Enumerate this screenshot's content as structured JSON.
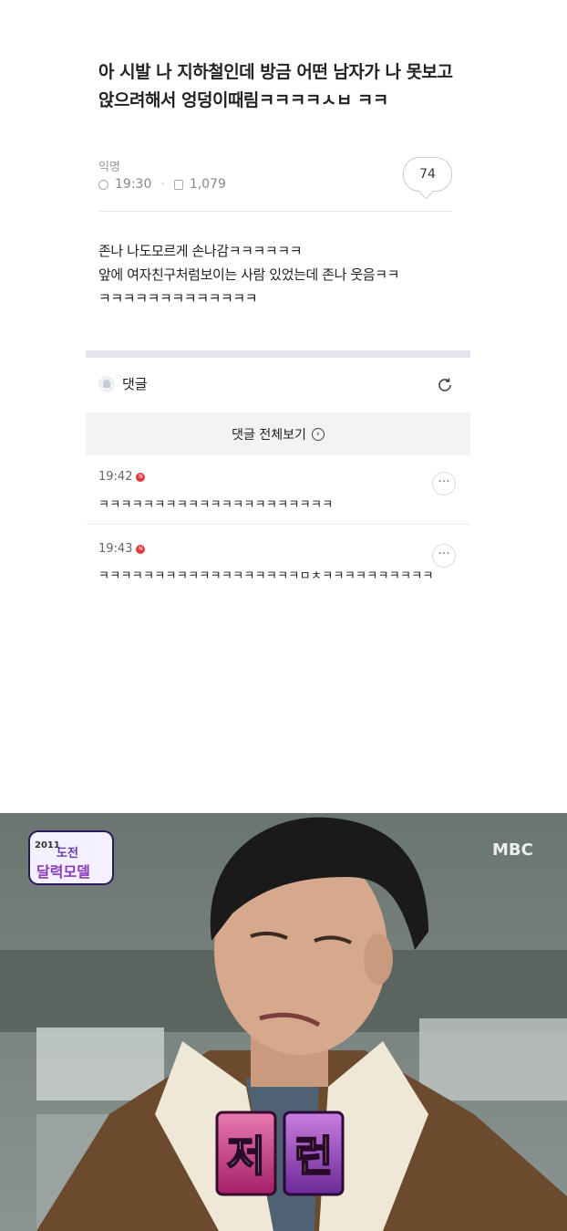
{
  "post": {
    "title": "아 시발 나 지하철인데 방금 어떤 남자가 나 못보고 앉으려해서 엉덩이때림ㅋㅋㅋㅋㅅㅂ ㅋㅋ",
    "author": "익명",
    "time": "19:30",
    "views": "1,079",
    "comment_count": "74",
    "body_lines": [
      "존나 나도모르게 손나감ㅋㅋㅋㅋㅋㅋ",
      "앞에 여자친구처럼보이는 사람 있었는데 존나 웃음ㅋㅋ",
      "ㅋㅋㅋㅋㅋㅋㅋㅋㅋㅋㅋㅋㅋ"
    ]
  },
  "comments_section": {
    "header": "댓글",
    "view_all": "댓글 전체보기",
    "comments": [
      {
        "time": "19:42",
        "badge": "N",
        "text": "ㅋㅋㅋㅋㅋㅋㅋㅋㅋㅋㅋㅋㅋㅋㅋㅋㅋㅋㅋㅋㅋ"
      },
      {
        "time": "19:43",
        "badge": "N",
        "text": "ㅋㅋㅋㅋㅋㅋㅋㅋㅋㅋㅋㅋㅋㅋㅋㅋㅋㅋㅁㅊㅋㅋㅋㅋㅋㅋㅋㅋㅋㅋ"
      }
    ]
  },
  "image": {
    "logo_year": "2011",
    "logo_text_1": "도전",
    "logo_text_2": "달력모델",
    "broadcaster": "MBC",
    "caption_1": "저",
    "caption_2": "런"
  },
  "colors": {
    "badge": "#e0393e",
    "divider": "#e3e4ee"
  }
}
